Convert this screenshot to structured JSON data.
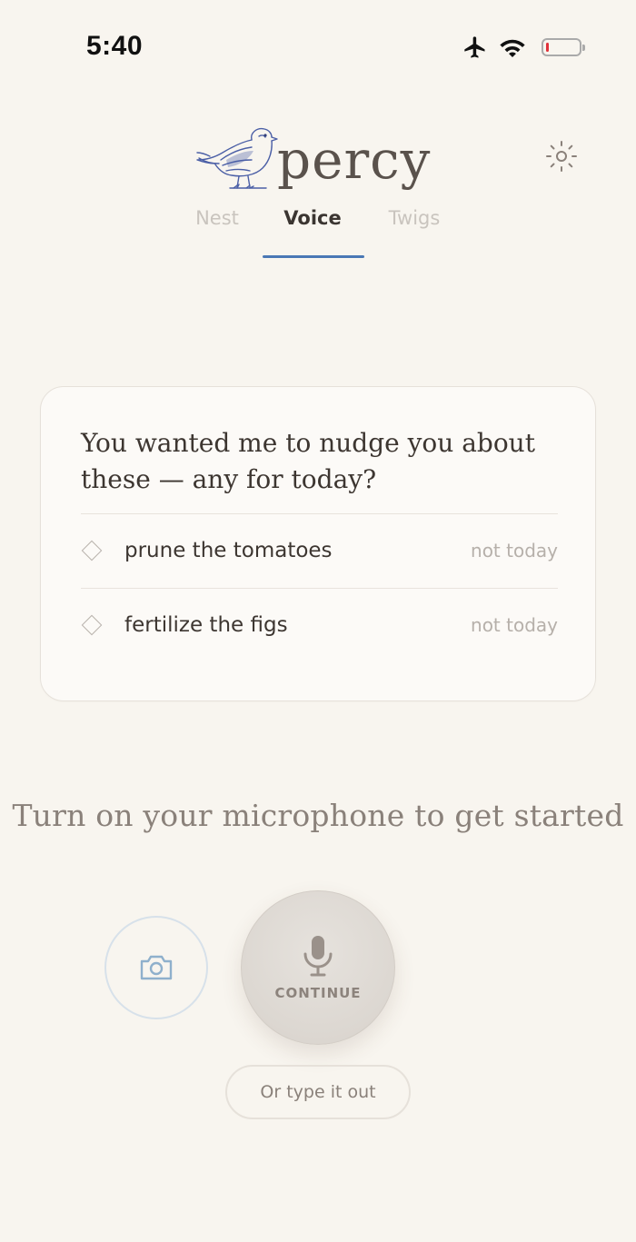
{
  "status_bar": {
    "time": "5:40",
    "icons": [
      "airplane-icon",
      "wifi-icon",
      "battery-icon"
    ],
    "battery_level": 0.1,
    "battery_color": "#e0323a"
  },
  "header": {
    "logo_text": "percy",
    "settings_icon": "settings-icon"
  },
  "tabs": [
    {
      "label": "Nest",
      "active": false
    },
    {
      "label": "Voice",
      "active": true
    },
    {
      "label": "Twigs",
      "active": false
    }
  ],
  "nudge_card": {
    "question": "You wanted me to nudge you about these — any for today?",
    "items": [
      {
        "label": "prune the tomatoes",
        "action": "not today"
      },
      {
        "label": "fertilize the figs",
        "action": "not today"
      }
    ]
  },
  "voice": {
    "prompt": "Turn on your microphone to get started",
    "camera_icon": "camera-icon",
    "mic_icon": "microphone-icon",
    "mic_label": "CONTINUE",
    "type_label": "Or type it out"
  },
  "colors": {
    "background": "#f8f5ef",
    "accent": "#4a78b5",
    "text_primary": "#3d3631",
    "text_muted": "#b6b0aa"
  }
}
